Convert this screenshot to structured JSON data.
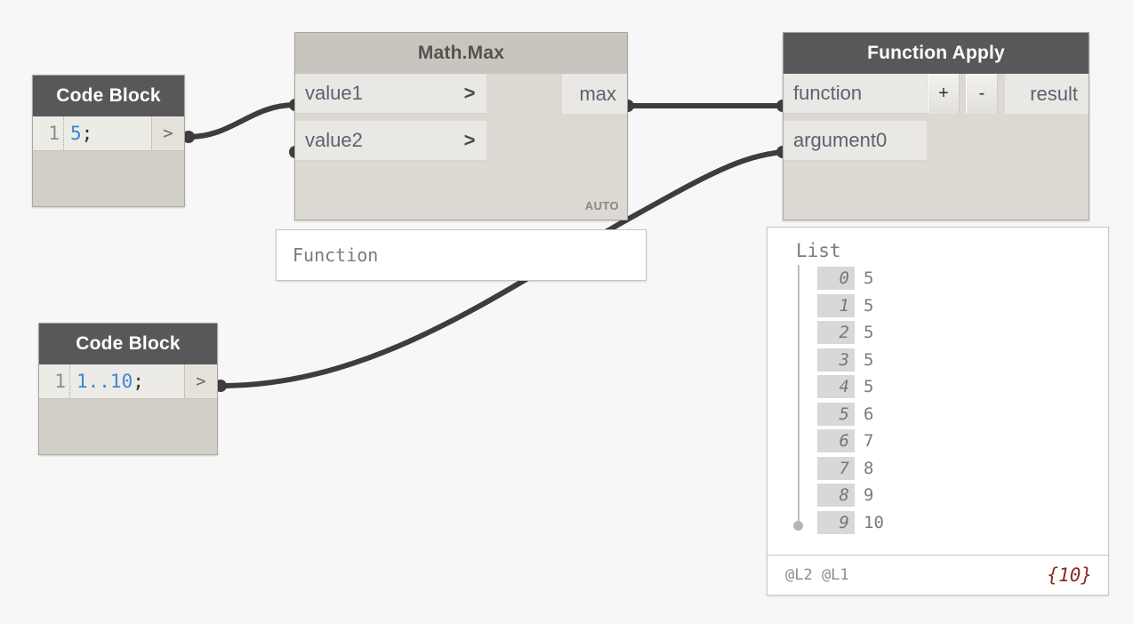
{
  "canvas": {
    "background": "#f7f7f7",
    "wire_color": "#3d3d3d"
  },
  "nodes": {
    "code_block_1": {
      "title": "Code Block",
      "line_number": "1",
      "code_value": "5",
      "code_terminator": ";",
      "output_port_label": ">"
    },
    "code_block_2": {
      "title": "Code Block",
      "line_number": "1",
      "code_value": "1..10",
      "code_terminator": ";",
      "output_port_label": ">"
    },
    "math_max": {
      "title": "Math.Max",
      "inputs": [
        {
          "label": "value1",
          "chevron": ">"
        },
        {
          "label": "value2",
          "chevron": ">"
        }
      ],
      "outputs": [
        {
          "label": "max"
        }
      ],
      "execution_tag": "AUTO"
    },
    "function_apply": {
      "title": "Function Apply",
      "inputs": [
        {
          "label": "function"
        },
        {
          "label": "argument0"
        }
      ],
      "outputs": [
        {
          "label": "result"
        }
      ],
      "add_button_label": "+",
      "remove_button_label": "-"
    }
  },
  "previews": {
    "math_max_preview": {
      "text": "Function"
    },
    "function_apply_preview": {
      "title": "List",
      "items": [
        {
          "index": "0",
          "value": "5"
        },
        {
          "index": "1",
          "value": "5"
        },
        {
          "index": "2",
          "value": "5"
        },
        {
          "index": "3",
          "value": "5"
        },
        {
          "index": "4",
          "value": "5"
        },
        {
          "index": "5",
          "value": "6"
        },
        {
          "index": "6",
          "value": "7"
        },
        {
          "index": "7",
          "value": "8"
        },
        {
          "index": "8",
          "value": "9"
        },
        {
          "index": "9",
          "value": "10"
        }
      ],
      "footer_levels": "@L2 @L1",
      "footer_count": "{10}"
    }
  }
}
